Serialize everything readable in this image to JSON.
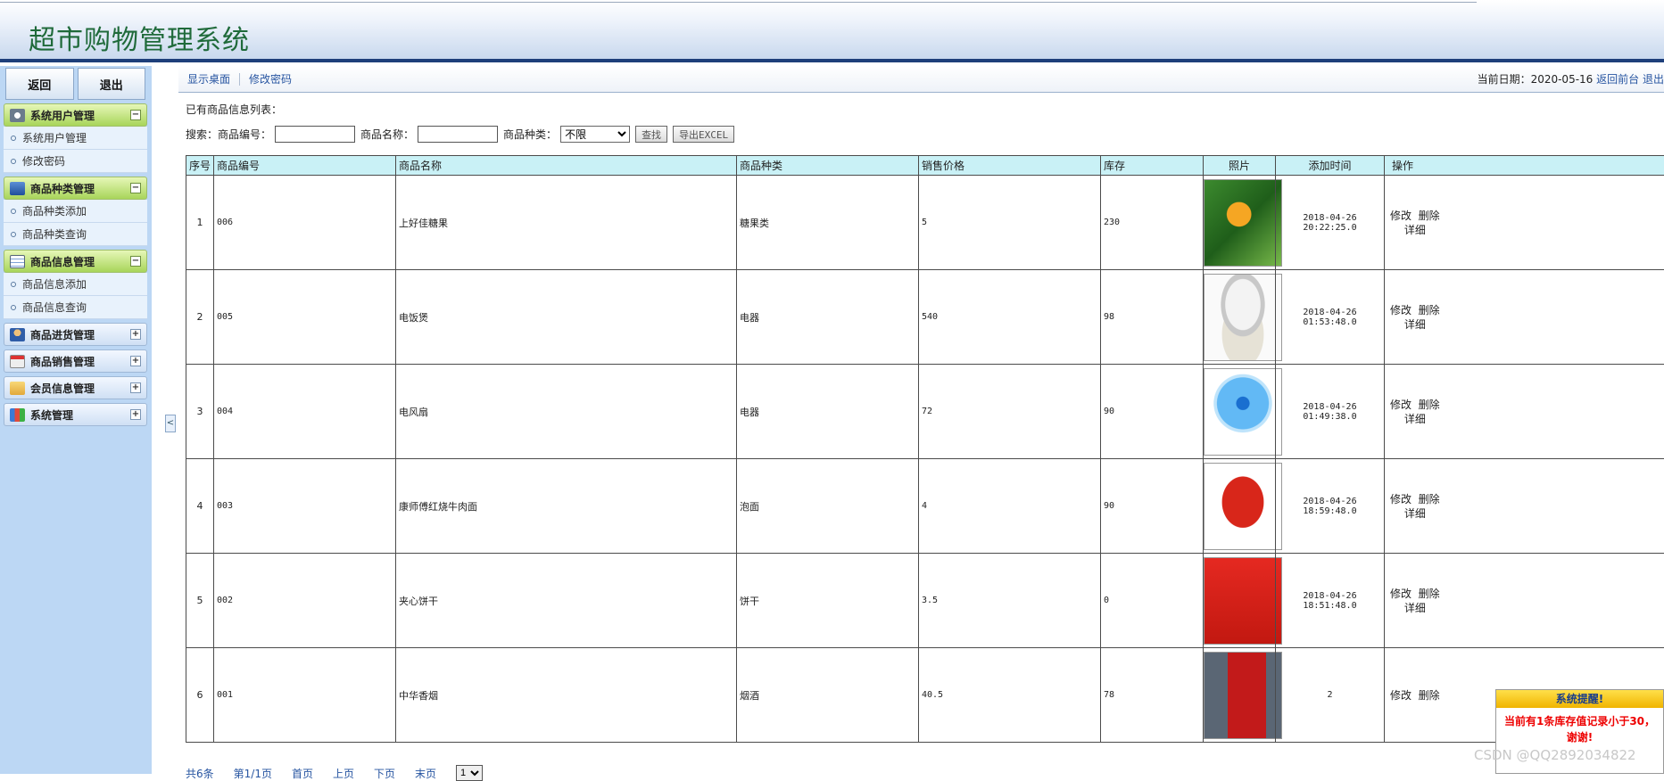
{
  "header": {
    "title": "超市购物管理系统"
  },
  "sidebar": {
    "back_label": "返回",
    "logout_label": "退出",
    "groups": [
      {
        "title": "系统用户管理",
        "open": true,
        "items": [
          "系统用户管理",
          "修改密码"
        ]
      },
      {
        "title": "商品种类管理",
        "open": true,
        "items": [
          "商品种类添加",
          "商品种类查询"
        ]
      },
      {
        "title": "商品信息管理",
        "open": true,
        "items": [
          "商品信息添加",
          "商品信息查询"
        ]
      },
      {
        "title": "商品进货管理",
        "open": false,
        "items": []
      },
      {
        "title": "商品销售管理",
        "open": false,
        "items": []
      },
      {
        "title": "会员信息管理",
        "open": false,
        "items": []
      },
      {
        "title": "系统管理",
        "open": false,
        "items": []
      }
    ],
    "collapse_symbol": "<"
  },
  "tabbar": {
    "home": "显示桌面",
    "change_pwd": "修改密码",
    "date_label": "当前日期：2020-05-16",
    "back_front": "返回前台",
    "logout": "退出"
  },
  "main": {
    "list_title": "已有商品信息列表：",
    "search": {
      "label": "搜索：",
      "code_label": "商品编号：",
      "name_label": "商品名称：",
      "type_label": "商品种类：",
      "type_selected": "不限",
      "search_button": "查找",
      "export_button": "导出EXCEL"
    },
    "columns": [
      "序号",
      "商品编号",
      "商品名称",
      "商品种类",
      "销售价格",
      "库存",
      "照片",
      "添加时间",
      "操作"
    ],
    "rows": [
      {
        "no": "1",
        "code": "006",
        "name": "上好佳糖果",
        "type": "糖果类",
        "price": "5",
        "stock": "230",
        "photo": "candy-photo",
        "time": "2018-04-26 20:22:25.0",
        "edit": "修改",
        "delete": "删除",
        "detail": "详细"
      },
      {
        "no": "2",
        "code": "005",
        "name": "电饭煲",
        "type": "电器",
        "price": "540",
        "stock": "98",
        "photo": "rice-cooker-photo",
        "time": "2018-04-26 01:53:48.0",
        "edit": "修改",
        "delete": "删除",
        "detail": "详细"
      },
      {
        "no": "3",
        "code": "004",
        "name": "电风扇",
        "type": "电器",
        "price": "72",
        "stock": "90",
        "photo": "fan-photo",
        "time": "2018-04-26 01:49:38.0",
        "edit": "修改",
        "delete": "删除",
        "detail": "详细"
      },
      {
        "no": "4",
        "code": "003",
        "name": "康师傅红烧牛肉面",
        "type": "泡面",
        "price": "4",
        "stock": "90",
        "photo": "noodles-photo",
        "time": "2018-04-26 18:59:48.0",
        "edit": "修改",
        "delete": "删除",
        "detail": "详细"
      },
      {
        "no": "5",
        "code": "002",
        "name": "夹心饼干",
        "type": "饼干",
        "price": "3.5",
        "stock": "0",
        "photo": "biscuit-photo",
        "time": "2018-04-26 18:51:48.0",
        "edit": "修改",
        "delete": "删除",
        "detail": "详细"
      },
      {
        "no": "6",
        "code": "001",
        "name": "中华香烟",
        "type": "烟酒",
        "price": "40.5",
        "stock": "78",
        "photo": "cigarette-photo",
        "time": "2",
        "edit": "修改",
        "delete": "删除",
        "detail": ""
      }
    ],
    "pager": {
      "total": "共6条",
      "page": "第1/1页",
      "first": "首页",
      "prev": "上页",
      "next": "下页",
      "last": "末页",
      "select": "1"
    }
  },
  "popup": {
    "title": "系统提醒!",
    "message": "当前有1条库存值记录小于30，谢谢!"
  },
  "watermark": "CSDN @QQ2892034822",
  "colors": {
    "header_border": "#1e3f7a",
    "sidebar_bg": "#bcd7f4",
    "table_header_bg": "#c9f1f6",
    "link": "#2755a1"
  }
}
